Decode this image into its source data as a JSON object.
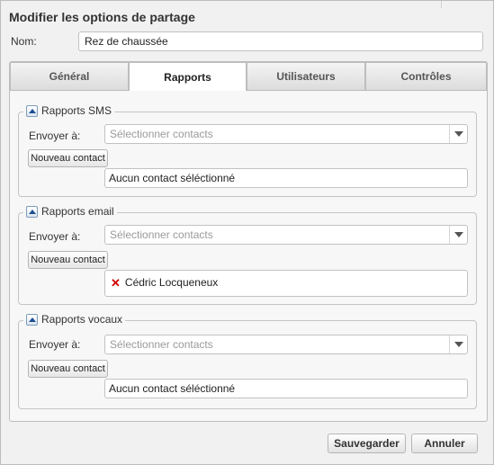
{
  "dialog": {
    "title": "Modifier les options de partage",
    "name_label": "Nom:",
    "name_value": "Rez de chaussée"
  },
  "tabs": [
    {
      "label": "Général",
      "active": false
    },
    {
      "label": "Rapports",
      "active": true
    },
    {
      "label": "Utilisateurs",
      "active": false
    },
    {
      "label": "Contrôles",
      "active": false
    }
  ],
  "sections": {
    "sms": {
      "legend": "Rapports SMS",
      "send_label": "Envoyer à:",
      "select_placeholder": "Sélectionner contacts",
      "new_contact_label": "Nouveau contact",
      "contacts_text": "Aucun contact séléctionné"
    },
    "email": {
      "legend": "Rapports email",
      "send_label": "Envoyer à:",
      "select_placeholder": "Sélectionner contacts",
      "new_contact_label": "Nouveau contact",
      "contacts": [
        "Cédric Locqueneux"
      ]
    },
    "voice": {
      "legend": "Rapports vocaux",
      "send_label": "Envoyer à:",
      "select_placeholder": "Sélectionner contacts",
      "new_contact_label": "Nouveau contact",
      "contacts_text": "Aucun contact séléctionné"
    }
  },
  "footer": {
    "save_label": "Sauvegarder",
    "cancel_label": "Annuler"
  },
  "colors": {
    "dialog_bg": "#f1f1f1",
    "panel_bg": "#f7f7f7",
    "border": "#bdbdbd",
    "remove_red": "#d00000",
    "placeholder_gray": "#9a9a9a"
  },
  "icons": {
    "collapse": "triangle-up-icon",
    "dropdown": "chevron-down-icon",
    "remove": "red-x-icon"
  }
}
